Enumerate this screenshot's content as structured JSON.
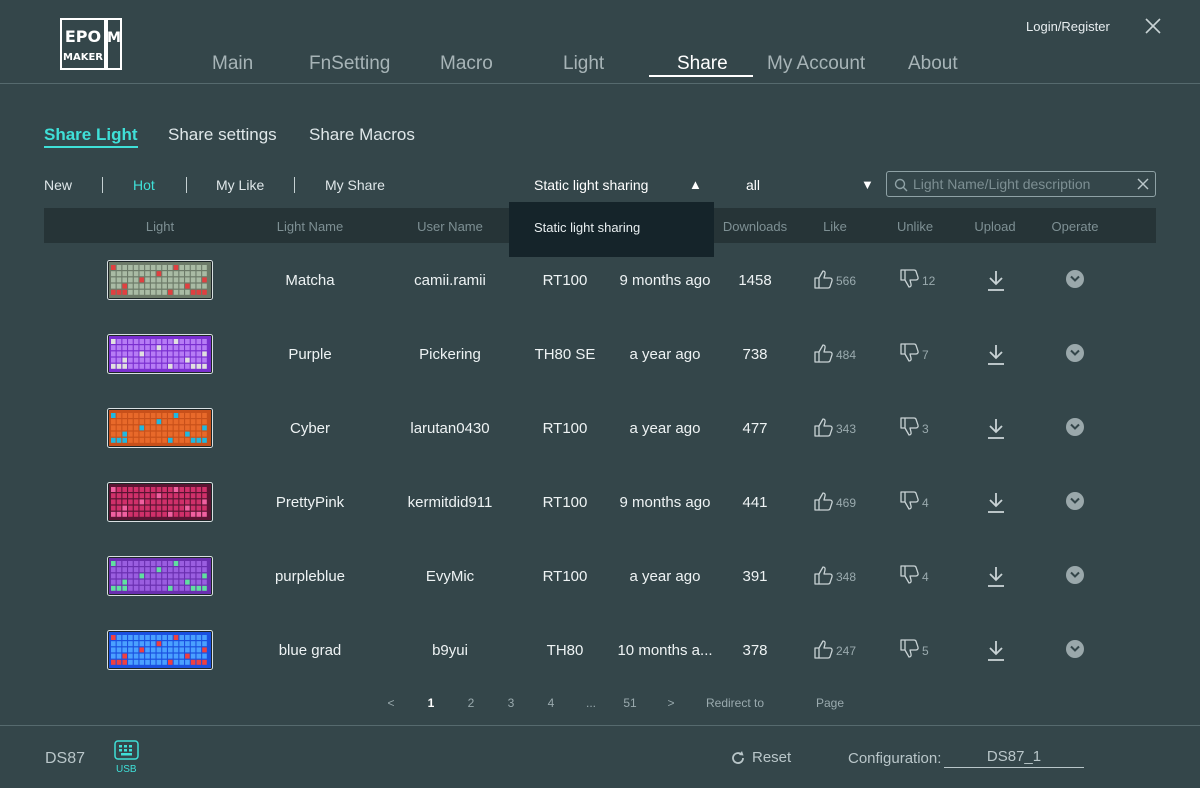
{
  "app": {
    "logo_text": "EPOMAKER",
    "login_label": "Login/Register"
  },
  "nav": {
    "items": [
      {
        "label": "Main"
      },
      {
        "label": "FnSetting"
      },
      {
        "label": "Macro"
      },
      {
        "label": "Light"
      },
      {
        "label": "Share"
      },
      {
        "label": "My Account"
      },
      {
        "label": "About"
      }
    ],
    "active": "Share"
  },
  "subtabs": {
    "items": [
      {
        "label": "Share Light"
      },
      {
        "label": "Share settings"
      },
      {
        "label": "Share Macros"
      }
    ],
    "active": "Share Light"
  },
  "filters": {
    "items": [
      {
        "label": "New"
      },
      {
        "label": "Hot"
      },
      {
        "label": "My Like"
      },
      {
        "label": "My Share"
      }
    ],
    "active": "Hot"
  },
  "type_dropdown": {
    "selected": "Static light sharing",
    "options": [
      "Static light sharing"
    ]
  },
  "scope_dropdown": {
    "selected": "all"
  },
  "search": {
    "placeholder": "Light Name/Light description",
    "value": ""
  },
  "table": {
    "columns": [
      "Light",
      "Light Name",
      "User Name",
      "",
      "",
      "Downloads",
      "Like",
      "Unlike",
      "Upload",
      "Operate"
    ],
    "rows": [
      {
        "name": "Matcha",
        "user": "camii.ramii",
        "model": "RT100",
        "time": "9 months ago",
        "downloads": "1458",
        "likes": "566",
        "unlikes": "12",
        "thumb": {
          "base": "#6c7a68",
          "keys": "#a9bba4",
          "accent": "#e04040"
        }
      },
      {
        "name": "Purple",
        "user": "Pickering",
        "model": "TH80 SE",
        "time": "a year ago",
        "downloads": "738",
        "likes": "484",
        "unlikes": "7",
        "thumb": {
          "base": "#7a2fd0",
          "keys": "#b67cf5",
          "accent": "#e0e0e0"
        }
      },
      {
        "name": "Cyber",
        "user": "larutan0430",
        "model": "RT100",
        "time": "a year ago",
        "downloads": "477",
        "likes": "343",
        "unlikes": "3",
        "thumb": {
          "base": "#c8501a",
          "keys": "#e8692a",
          "accent": "#20b8e0"
        }
      },
      {
        "name": "PrettyPink",
        "user": "kermitdid911",
        "model": "RT100",
        "time": "9 months ago",
        "downloads": "441",
        "likes": "469",
        "unlikes": "4",
        "thumb": {
          "base": "#5a1432",
          "keys": "#d0306a",
          "accent": "#f060a0"
        }
      },
      {
        "name": "purpleblue",
        "user": "EvyMic",
        "model": "RT100",
        "time": "a year ago",
        "downloads": "391",
        "likes": "348",
        "unlikes": "4",
        "thumb": {
          "base": "#6a2fb0",
          "keys": "#9a5ee0",
          "accent": "#60e0a0"
        }
      },
      {
        "name": "blue grad",
        "user": "b9yui",
        "model": "TH80",
        "time": "10 months a...",
        "downloads": "378",
        "likes": "247",
        "unlikes": "5",
        "thumb": {
          "base": "#1a50e0",
          "keys": "#4aa0ff",
          "accent": "#f04040"
        }
      }
    ]
  },
  "pagination": {
    "prev": "<",
    "pages": [
      "1",
      "2",
      "3",
      "4",
      "...",
      "51"
    ],
    "current": "1",
    "next": ">",
    "redirect_label": "Redirect to",
    "page_label": "Page"
  },
  "footer": {
    "device": "DS87",
    "connection": "USB",
    "reset_label": "Reset",
    "config_label": "Configuration:",
    "config_value": "DS87_1"
  },
  "colors": {
    "background": "#34464a",
    "accent": "#3fe0d8",
    "table_header": "#263437",
    "dropdown_bg": "#15242a"
  }
}
